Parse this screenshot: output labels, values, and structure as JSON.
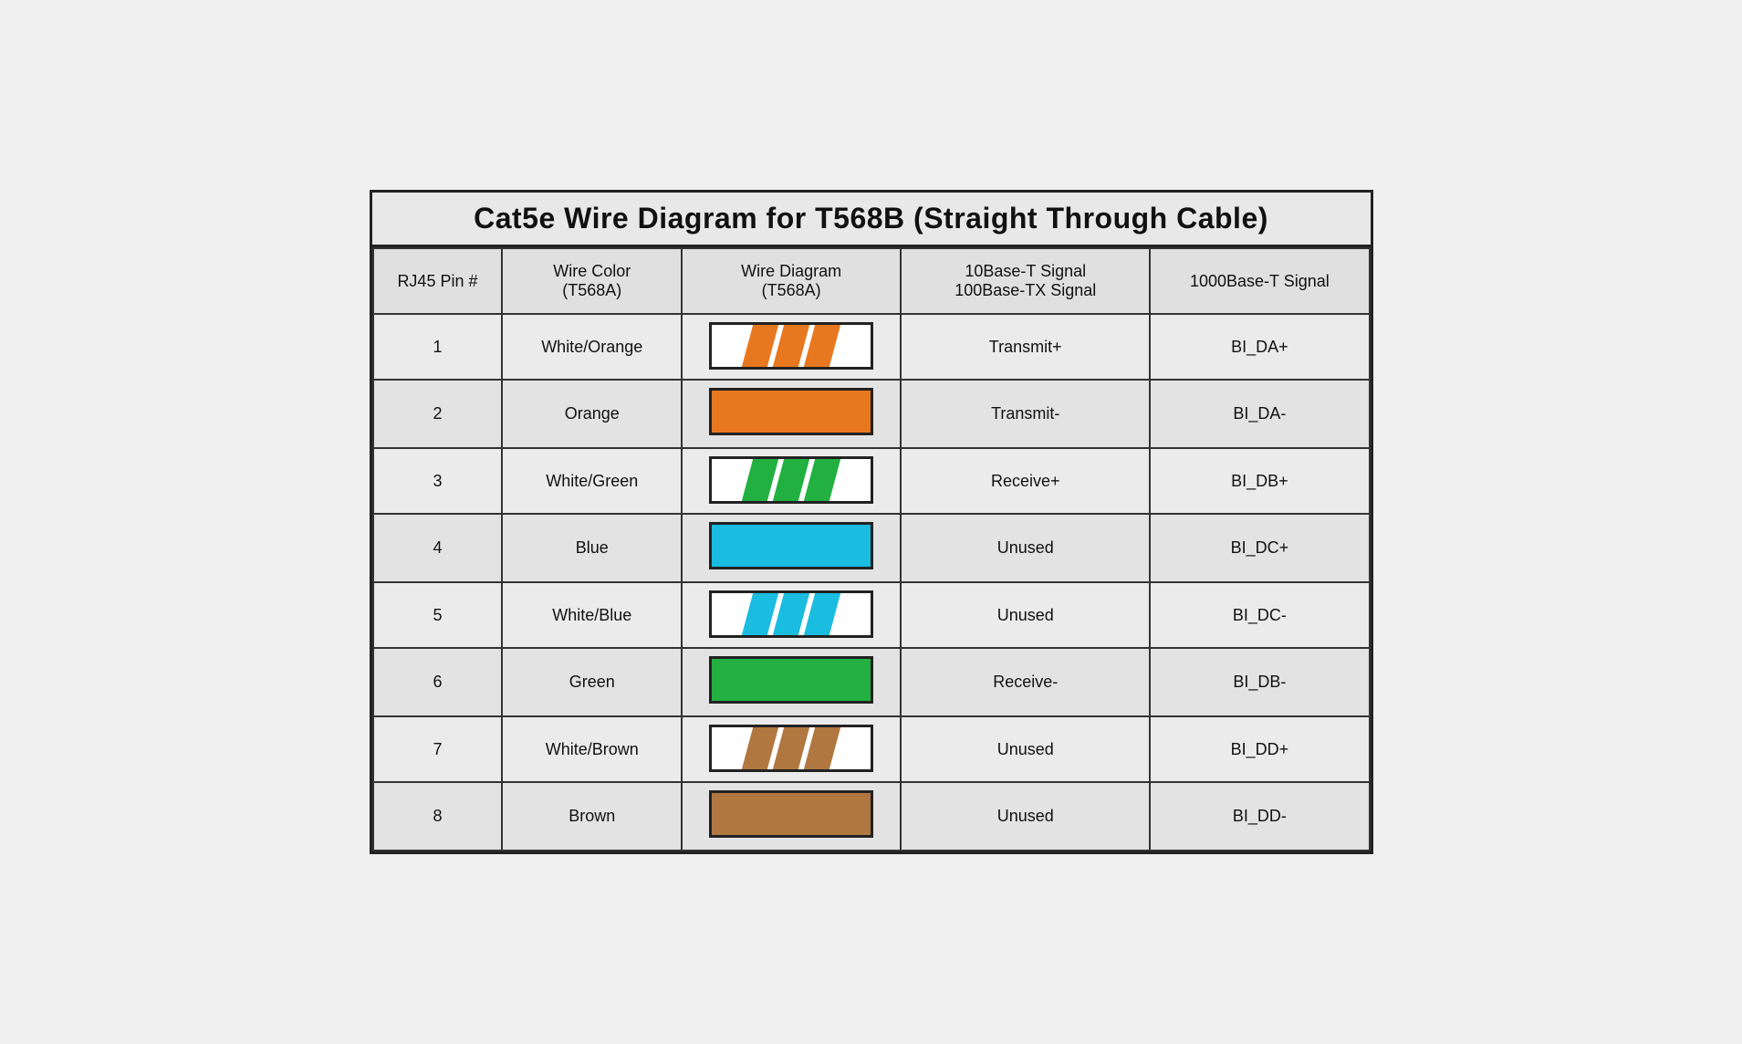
{
  "title": "Cat5e Wire Diagram for T568B (Straight Through Cable)",
  "headers": {
    "pin": "RJ45 Pin #",
    "color": "Wire Color\n(T568A)",
    "diagram": "Wire Diagram\n(T568A)",
    "signal10_100": "10Base-T Signal\n100Base-TX Signal",
    "signal1000": "1000Base-T Signal"
  },
  "rows": [
    {
      "pin": "1",
      "color": "White/Orange",
      "wire_type": "stripe",
      "wire_color": "#E87820",
      "signal_10_100": "Transmit+",
      "signal_1000": "BI_DA+"
    },
    {
      "pin": "2",
      "color": "Orange",
      "wire_type": "solid",
      "wire_color": "#E87820",
      "signal_10_100": "Transmit-",
      "signal_1000": "BI_DA-"
    },
    {
      "pin": "3",
      "color": "White/Green",
      "wire_type": "stripe",
      "wire_color": "#22B040",
      "signal_10_100": "Receive+",
      "signal_1000": "BI_DB+"
    },
    {
      "pin": "4",
      "color": "Blue",
      "wire_type": "solid",
      "wire_color": "#1ABCE0",
      "signal_10_100": "Unused",
      "signal_1000": "BI_DC+"
    },
    {
      "pin": "5",
      "color": "White/Blue",
      "wire_type": "stripe",
      "wire_color": "#1ABCE0",
      "signal_10_100": "Unused",
      "signal_1000": "BI_DC-"
    },
    {
      "pin": "6",
      "color": "Green",
      "wire_type": "solid",
      "wire_color": "#22B040",
      "signal_10_100": "Receive-",
      "signal_1000": "BI_DB-"
    },
    {
      "pin": "7",
      "color": "White/Brown",
      "wire_type": "stripe",
      "wire_color": "#B07840",
      "signal_10_100": "Unused",
      "signal_1000": "BI_DD+"
    },
    {
      "pin": "8",
      "color": "Brown",
      "wire_type": "solid",
      "wire_color": "#B07840",
      "signal_10_100": "Unused",
      "signal_1000": "BI_DD-"
    }
  ]
}
